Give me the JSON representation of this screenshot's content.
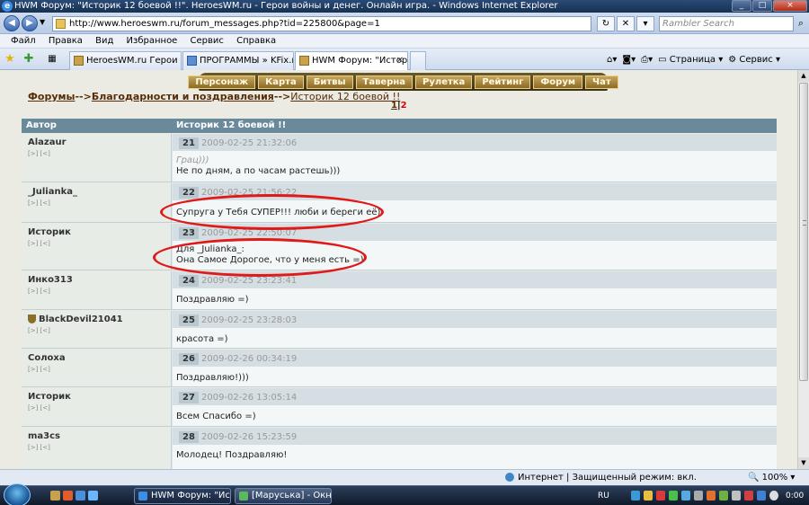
{
  "window": {
    "title": "HWM Форум: \"Историк 12 боевой !!\". HeroesWM.ru - Герои войны и денег. Онлайн игра. - Windows Internet Explorer"
  },
  "browser": {
    "url": "http://www.heroeswm.ru/forum_messages.php?tid=225800&page=1",
    "search_placeholder": "Rambler Search",
    "menu": [
      "Файл",
      "Правка",
      "Вид",
      "Избранное",
      "Сервис",
      "Справка"
    ],
    "tabs": [
      {
        "label": "HeroesWM.ru Герои войн...",
        "active": false
      },
      {
        "label": "ПРОГРАММЫ » KFix.ru - ...",
        "active": false
      },
      {
        "label": "HWM Форум: \"Истори...",
        "active": true
      }
    ],
    "command_bar": {
      "page_label": "Страница",
      "tools_label": "Сервис"
    }
  },
  "game_nav": [
    "Персонаж",
    "Карта",
    "Битвы",
    "Таверна",
    "Рулетка",
    "Рейтинг",
    "Форум",
    "Чат"
  ],
  "breadcrumb": {
    "forums": "Форумы",
    "section": "Благодарности и поздравления",
    "separator": "-->",
    "topic": "Историк 12 боевой !!"
  },
  "pagination": {
    "page1": "1",
    "sep": "|",
    "current": "2"
  },
  "table": {
    "author_header": "Автор",
    "topic_header": "Историк 12 боевой !!",
    "small_links": "[>] [<]"
  },
  "posts": [
    {
      "author": "Alazaur",
      "num": "21",
      "date": "2009-02-25 21:32:06",
      "quote": "Грац)))",
      "text": "Не по дням, а по часам растешь)))"
    },
    {
      "author": "_Julianka_",
      "num": "22",
      "date": "2009-02-25 21:56:22",
      "text": "Супруга у Тебя СУПЕР!!! люби и береги её)"
    },
    {
      "author": "Историк",
      "num": "23",
      "date": "2009-02-25 22:50:07",
      "line1": "Для _Julianka_:",
      "line2": "Она Самое Дорогое, что у меня есть =)"
    },
    {
      "author": "Инко313",
      "num": "24",
      "date": "2009-02-25 23:23:41",
      "text": "Поздравляю =)"
    },
    {
      "author": "BlackDevil21041",
      "num": "25",
      "date": "2009-02-25 23:28:03",
      "text": "красота =)"
    },
    {
      "author": "Солоха",
      "num": "26",
      "date": "2009-02-26 00:34:19",
      "text": "Поздравляю!)))"
    },
    {
      "author": "Историк",
      "num": "27",
      "date": "2009-02-26 13:05:14",
      "text": "Всем Спасибо =)"
    },
    {
      "author": "ma3cs",
      "num": "28",
      "date": "2009-02-26 15:23:59",
      "text": "Молодец! Поздравляю!"
    }
  ],
  "status": {
    "zone": "Интернет | Защищенный режим: вкл.",
    "zoom": "100%"
  },
  "taskbar": {
    "buttons": [
      {
        "label": "HWM Форум: \"Истор...",
        "active": true
      },
      {
        "label": "[Маруська] - Окно ...",
        "active": false
      }
    ],
    "lang": "RU",
    "clock": "0:00"
  },
  "colors": {
    "annotation_ellipse": "#e01919",
    "breadcrumb_link": "#592c08",
    "table_header": "#6a8a9b"
  }
}
